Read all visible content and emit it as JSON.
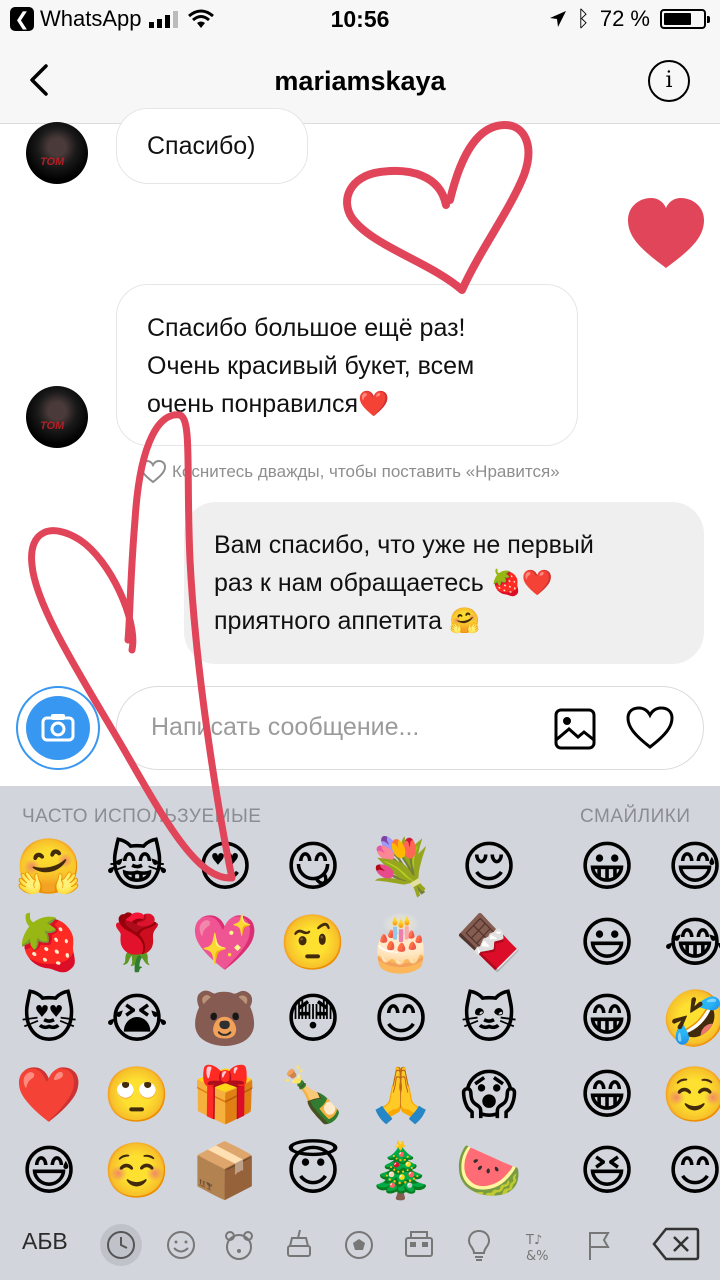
{
  "status_bar": {
    "back_app": "WhatsApp",
    "time": "10:56",
    "battery": "72 %",
    "battery_level": 0.72
  },
  "header": {
    "username": "mariamskaya"
  },
  "messages": [
    {
      "direction": "incoming",
      "text_lines": [
        "Спасибо)"
      ]
    },
    {
      "direction": "incoming",
      "text_lines": [
        "Спасибо большое ещё раз!",
        "Очень красивый букет, всем",
        "очень понравился❤️"
      ]
    },
    {
      "direction": "outgoing",
      "text_lines": [
        "Вам спасибо, что уже не первый",
        "раз к нам обращаетесь 🍓❤️",
        "приятного аппетита 🤗"
      ]
    }
  ],
  "like_hint": "Коснитесь дважды, чтобы поставить «Нравится»",
  "composer": {
    "placeholder": "Написать сообщение..."
  },
  "keyboard": {
    "category_frequent": "ЧАСТО ИСПОЛЬЗУЕМЫЕ",
    "category_smileys": "СМАЙЛИКИ",
    "abc_label": "АБВ",
    "frequent_emojis": [
      [
        "🤗",
        "😹",
        "😍",
        "😋",
        "💐",
        "😌"
      ],
      [
        "🍓",
        "🌹",
        "💖",
        "🤨",
        "🎂",
        "🍫"
      ],
      [
        "😻",
        "😭",
        "🐻",
        "😳",
        "😊",
        "🐱"
      ],
      [
        "❤️",
        "🙄",
        "🎁",
        "🍾",
        "🙏",
        "😱"
      ],
      [
        "😅",
        "☺️",
        "📦",
        "😇",
        "🎄",
        "🍉"
      ]
    ],
    "smiley_emojis": [
      [
        "😀",
        "😅"
      ],
      [
        "😃",
        "😂"
      ],
      [
        "😁",
        "🤣"
      ],
      [
        "😁",
        "☺️"
      ],
      [
        "😆",
        "😊"
      ]
    ]
  },
  "colors": {
    "accent": "#3897f0",
    "overlay_heart": "#e0455a"
  }
}
